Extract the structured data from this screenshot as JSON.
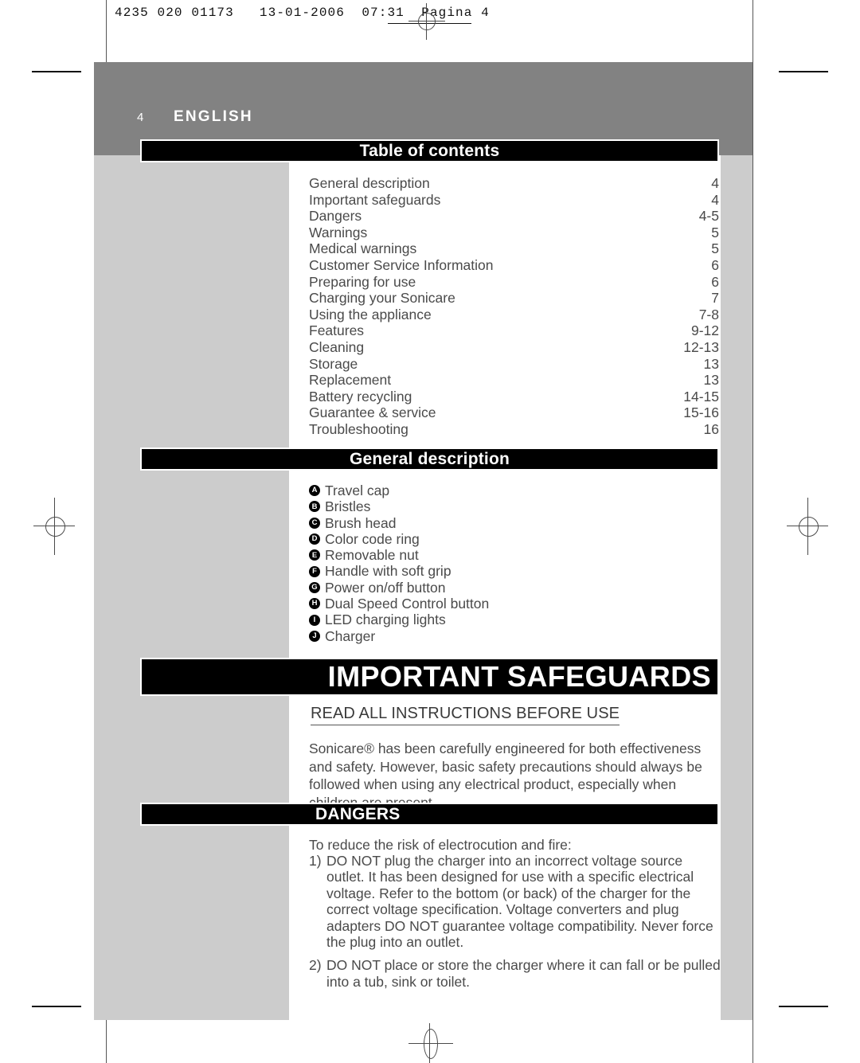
{
  "printer_mark": {
    "text": "4235 020 01173   13-01-2006  07:31  Pagina 4"
  },
  "header": {
    "folio": "4",
    "language": "ENGLISH"
  },
  "sections": {
    "toc_heading": "Table of contents",
    "general_description_heading": "General description",
    "important_safeguards_heading": "IMPORTANT SAFEGUARDS",
    "dangers_heading": "DANGERS"
  },
  "toc": {
    "entries": [
      {
        "title": "General description",
        "pages": "4"
      },
      {
        "title": "Important safeguards",
        "pages": "4"
      },
      {
        "title": "Dangers",
        "pages": "4-5"
      },
      {
        "title": "Warnings",
        "pages": "5"
      },
      {
        "title": "Medical warnings",
        "pages": "5"
      },
      {
        "title": "Customer Service Information",
        "pages": "6"
      },
      {
        "title": "Preparing for use",
        "pages": "6"
      },
      {
        "title": "Charging your Sonicare",
        "pages": "7"
      },
      {
        "title": "Using the appliance",
        "pages": "7-8"
      },
      {
        "title": "Features",
        "pages": "9-12"
      },
      {
        "title": "Cleaning",
        "pages": "12-13"
      },
      {
        "title": "Storage",
        "pages": "13"
      },
      {
        "title": "Replacement",
        "pages": "13"
      },
      {
        "title": "Battery recycling",
        "pages": "14-15"
      },
      {
        "title": "Guarantee & service",
        "pages": "15-16"
      },
      {
        "title": "Troubleshooting",
        "pages": "16"
      }
    ]
  },
  "general_description": {
    "parts": [
      {
        "letter": "A",
        "label": "Travel cap"
      },
      {
        "letter": "B",
        "label": "Bristles"
      },
      {
        "letter": "C",
        "label": "Brush head"
      },
      {
        "letter": "D",
        "label": "Color code ring"
      },
      {
        "letter": "E",
        "label": "Removable nut"
      },
      {
        "letter": "F",
        "label": "Handle with soft grip"
      },
      {
        "letter": "G",
        "label": "Power on/off button"
      },
      {
        "letter": "H",
        "label": "Dual Speed Control button"
      },
      {
        "letter": "I",
        "label": "LED charging lights"
      },
      {
        "letter": "J",
        "label": "Charger"
      }
    ]
  },
  "important_safeguards": {
    "read_all": "READ ALL INSTRUCTIONS BEFORE USE",
    "intro": "Sonicare® has been carefully engineered for both effectiveness and safety. However, basic safety precautions should always be followed when using any electrical product, especially when children are present."
  },
  "dangers": {
    "lead": "To reduce the risk of electrocution and fire:",
    "items": [
      {
        "number": "1)",
        "text": "DO NOT plug the charger into an incorrect voltage source outlet. It has been designed for use with a specific electrical voltage. Refer to the bottom (or back) of the charger for the correct voltage specification. Voltage converters and plug adapters DO NOT guarantee voltage compatibility. Never force the plug into an outlet."
      },
      {
        "number": "2)",
        "text": "DO NOT place or store the charger where it can fall or be pulled into a tub, sink or toilet."
      }
    ]
  },
  "colors": {
    "header_band": "#828282",
    "side_panel": "#cccccc",
    "banner": "#000000",
    "body_text": "#4a4a4a"
  }
}
